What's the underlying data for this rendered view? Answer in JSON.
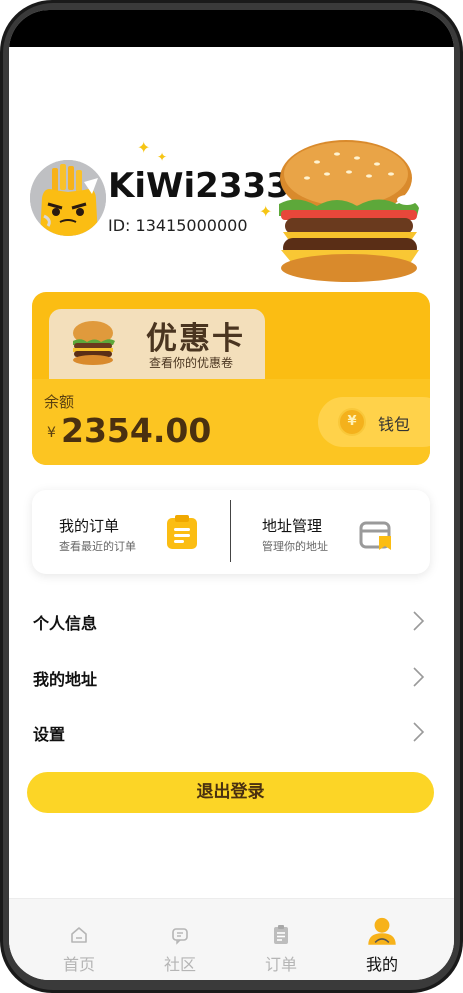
{
  "profile": {
    "username": "KiWi2333",
    "user_id": "ID: 13415000000"
  },
  "coupon_card": {
    "title": "优惠卡",
    "subtitle": "查看你的优惠卷",
    "balance_label": "余额",
    "currency_symbol": "¥",
    "balance_value": "2354.00",
    "wallet_label": "钱包",
    "wallet_icon_glyph": "¥"
  },
  "quick_actions": [
    {
      "title": "我的订单",
      "subtitle": "查看最近的订单",
      "icon": "clipboard-icon"
    },
    {
      "title": "地址管理",
      "subtitle": "管理你的地址",
      "icon": "address-card-icon"
    }
  ],
  "menu": [
    {
      "label": "个人信息"
    },
    {
      "label": "我的地址"
    },
    {
      "label": "设置"
    }
  ],
  "logout_label": "退出登录",
  "tabs": [
    {
      "label": "首页",
      "icon": "home-icon",
      "active": false
    },
    {
      "label": "社区",
      "icon": "chat-icon",
      "active": false
    },
    {
      "label": "订单",
      "icon": "order-icon",
      "active": false
    },
    {
      "label": "我的",
      "icon": "profile-icon",
      "active": true
    }
  ],
  "colors": {
    "accent_yellow": "#fbbd13",
    "button_yellow": "#fcd526",
    "tab_active": "#111111",
    "tab_inactive": "#b5b5b5"
  }
}
